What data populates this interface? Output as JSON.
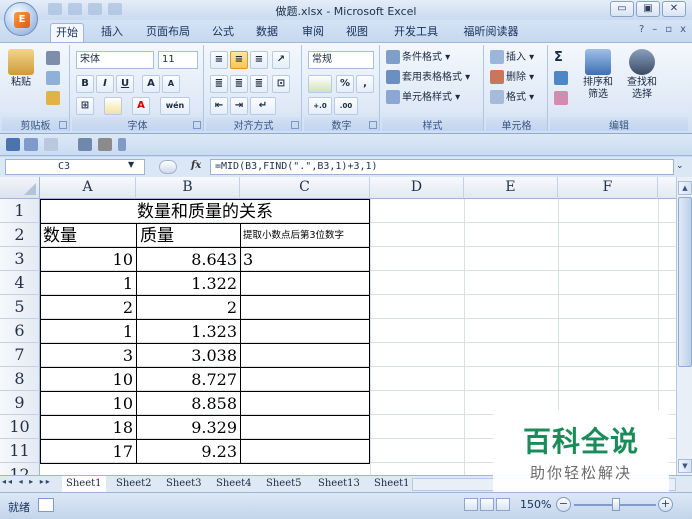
{
  "window": {
    "title": "做题.xlsx - Microsoft Excel",
    "minimize": "▭",
    "restore": "▣",
    "close": "✕"
  },
  "office_button": {
    "logo": "E"
  },
  "tabs": [
    {
      "label": "开始",
      "active": true
    },
    {
      "label": "插入"
    },
    {
      "label": "页面布局"
    },
    {
      "label": "公式"
    },
    {
      "label": "数据"
    },
    {
      "label": "审阅"
    },
    {
      "label": "视图"
    },
    {
      "label": "开发工具"
    },
    {
      "label": "福昕阅读器"
    }
  ],
  "tab_right": {
    "help": "?",
    "min": "–",
    "restore": "▫",
    "close": "x"
  },
  "ribbon": {
    "clipboard": {
      "label": "剪贴板",
      "paste": "粘贴"
    },
    "font": {
      "label": "字体",
      "name": "宋体",
      "size": "11",
      "bold": "B",
      "italic": "I",
      "underline": "U",
      "grow": "A",
      "shrink": "A",
      "wen": "wén"
    },
    "alignment": {
      "label": "对齐方式"
    },
    "number": {
      "label": "数字",
      "format": "常规",
      "percent": "%",
      "comma": ",",
      "inc": "+.0",
      "dec": ".00"
    },
    "styles": {
      "label": "样式",
      "conditional": "条件格式",
      "table": "套用表格格式",
      "cell": "单元格样式"
    },
    "cells": {
      "label": "单元格",
      "insert": "插入",
      "delete": "删除",
      "format": "格式"
    },
    "editing": {
      "label": "编辑",
      "sigma": "Σ",
      "sort": "排序和\n筛选",
      "find": "查找和\n选择"
    }
  },
  "formula_bar": {
    "cell_ref": "C3",
    "fx": "fx",
    "formula": "=MID(B3,FIND(\".\",B3,1)+3,1)"
  },
  "columns": [
    "A",
    "B",
    "C",
    "D",
    "E",
    "F"
  ],
  "rows": [
    "1",
    "2",
    "3",
    "4",
    "5",
    "6",
    "7",
    "8",
    "9",
    "10",
    "11",
    "12"
  ],
  "sheet": {
    "title": "数量和质量的关系",
    "headers": {
      "a": "数量",
      "b": "质量",
      "c": "提取小数点后第3位数字"
    },
    "data": [
      {
        "a": "10",
        "b": "8.643",
        "c": "3"
      },
      {
        "a": "1",
        "b": "1.322",
        "c": ""
      },
      {
        "a": "2",
        "b": "2",
        "c": ""
      },
      {
        "a": "1",
        "b": "1.323",
        "c": ""
      },
      {
        "a": "3",
        "b": "3.038",
        "c": ""
      },
      {
        "a": "10",
        "b": "8.727",
        "c": ""
      },
      {
        "a": "10",
        "b": "8.858",
        "c": ""
      },
      {
        "a": "18",
        "b": "9.329",
        "c": ""
      },
      {
        "a": "17",
        "b": "9.23",
        "c": ""
      }
    ]
  },
  "sheet_tabs": [
    "Sheet1",
    "Sheet2",
    "Sheet3",
    "Sheet4",
    "Sheet5",
    "Sheet13",
    "Sheet1"
  ],
  "sheet_nav": "◂◂ ◂ ▸ ▸▸",
  "status": {
    "ready": "就绪",
    "zoom": "150%",
    "zoom_minus": "−",
    "zoom_plus": "+"
  },
  "watermark": {
    "title": "百科全说",
    "subtitle": "助你轻松解决"
  }
}
